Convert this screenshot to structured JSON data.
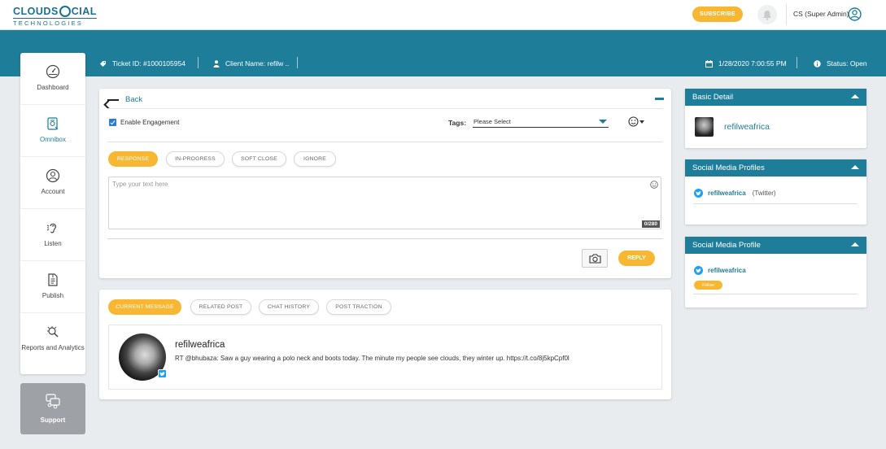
{
  "brand": {
    "logo_left": "CLOUDS",
    "logo_right": "CIAL",
    "logo_sub": "TECHNOLOGIES"
  },
  "header": {
    "subscribe_label": "SUBSCRIBE",
    "user_label": "CS (Super Admin)"
  },
  "ticket": {
    "ticket_id": "Ticket ID: #1000105954",
    "client_name": "Client Name: refilw ..",
    "datetime": "1/28/2020 7:00:55 PM",
    "status": "Status: Open"
  },
  "sidebar": {
    "items": [
      {
        "label": "Dashboard",
        "icon": "dashboard-gauge-icon"
      },
      {
        "label": "Omnibox",
        "icon": "omnibox-icon"
      },
      {
        "label": "Account",
        "icon": "account-icon"
      },
      {
        "label": "Listen",
        "icon": "listen-ear-icon"
      },
      {
        "label": "Publish",
        "icon": "publish-icon"
      },
      {
        "label": "Reports and Analytics",
        "icon": "reports-icon"
      }
    ],
    "active_index": 1,
    "support_label": "Support"
  },
  "composer": {
    "back_label": "Back",
    "enable_engagement_label": "Enable Engagement",
    "enable_engagement_checked": true,
    "tags_label": "Tags:",
    "tags_value": "Please Select",
    "status_tabs": [
      {
        "label": "RESPONSE",
        "active": true
      },
      {
        "label": "IN-PROGRESS",
        "active": false
      },
      {
        "label": "SOFT CLOSE",
        "active": false
      },
      {
        "label": "IGNORE",
        "active": false
      }
    ],
    "placeholder": "Type your text here",
    "char_counter": "0/280",
    "reply_label": "REPLY"
  },
  "message": {
    "tabs": [
      {
        "label": "CURRENT MESSAGE",
        "active": true
      },
      {
        "label": "RELATED POST",
        "active": false
      },
      {
        "label": "CHAT HISTORY",
        "active": false
      },
      {
        "label": "POST TRACTION",
        "active": false
      }
    ],
    "username": "refilweafrica",
    "text": "RT @bhubaza: Saw a guy wearing a polo neck and boots today. The minute my people see clouds, they winter up. https://t.co/8j5kpCpf0l"
  },
  "right_panels": {
    "basic_detail": {
      "title": "Basic Detail",
      "name": "refilweafrica"
    },
    "social_profiles": {
      "title": "Social Media Profiles",
      "handle": "refilweafrica",
      "network": "(Twitter)"
    },
    "social_profile": {
      "title": "Social Media Profile",
      "handle": "refilweafrica",
      "follow_label": "Follow"
    }
  },
  "colors": {
    "teal": "#1e7d99",
    "accent_yellow": "#f7b733",
    "twitter_blue": "#1da1f2"
  }
}
